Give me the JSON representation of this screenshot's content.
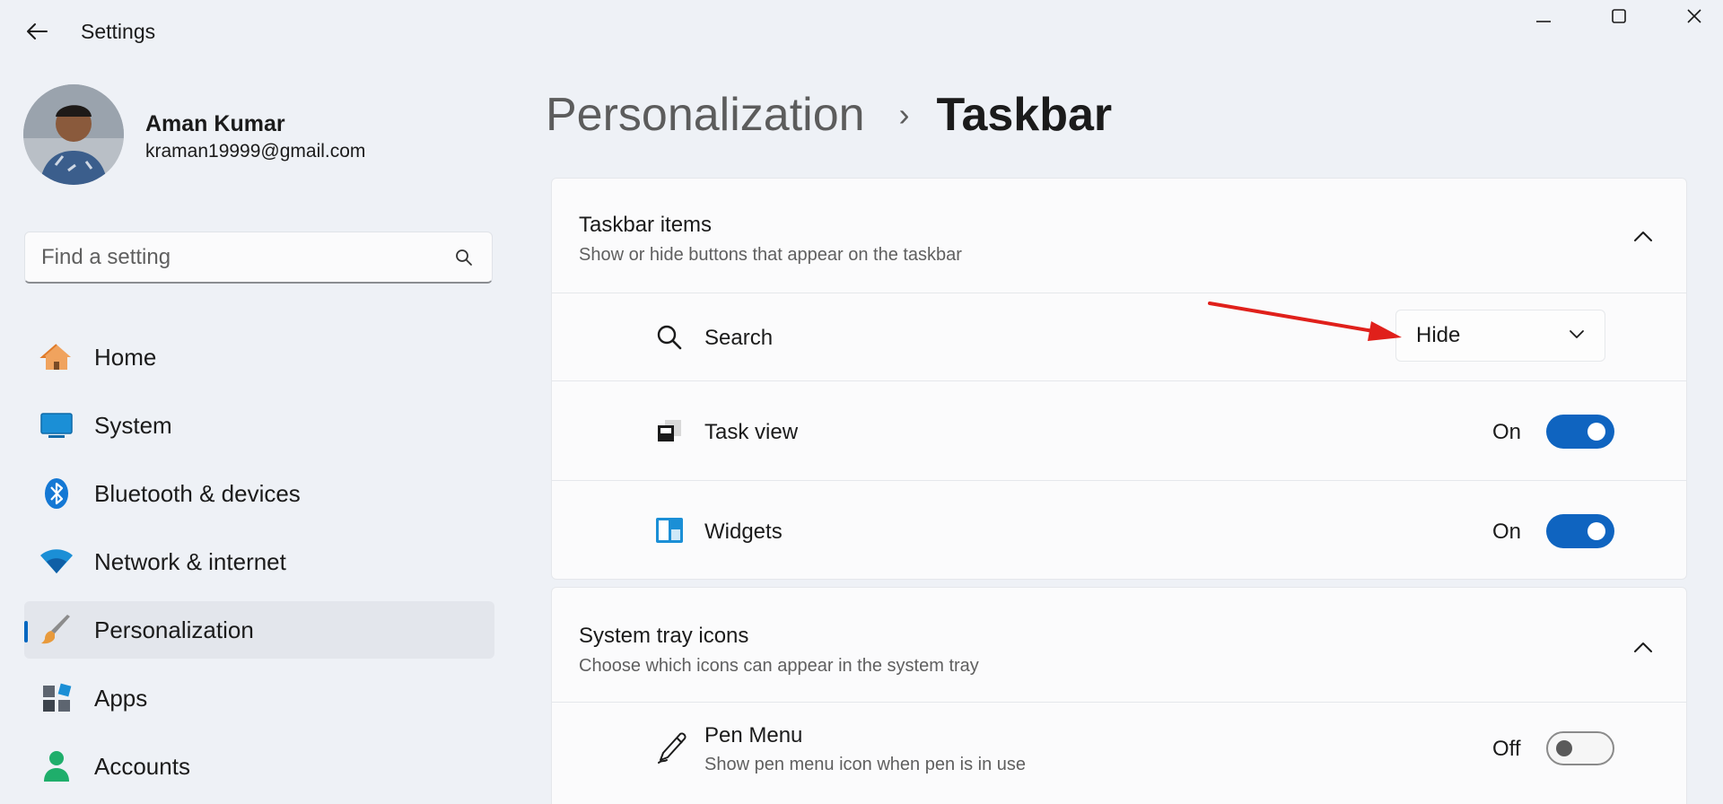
{
  "window": {
    "title": "Settings"
  },
  "user": {
    "name": "Aman Kumar",
    "email": "kraman19999@gmail.com"
  },
  "search": {
    "placeholder": "Find a setting"
  },
  "nav": {
    "items": [
      {
        "label": "Home",
        "icon": "home-icon"
      },
      {
        "label": "System",
        "icon": "display-icon"
      },
      {
        "label": "Bluetooth & devices",
        "icon": "bluetooth-icon"
      },
      {
        "label": "Network & internet",
        "icon": "wifi-icon"
      },
      {
        "label": "Personalization",
        "icon": "brush-icon",
        "active": true
      },
      {
        "label": "Apps",
        "icon": "apps-icon"
      },
      {
        "label": "Accounts",
        "icon": "person-icon"
      }
    ]
  },
  "breadcrumb": {
    "parent": "Personalization",
    "separator": "›",
    "current": "Taskbar"
  },
  "sections": [
    {
      "title": "Taskbar items",
      "subtitle": "Show or hide buttons that appear on the taskbar",
      "rows": [
        {
          "label": "Search",
          "control": "dropdown",
          "value": "Hide",
          "icon": "search-icon"
        },
        {
          "label": "Task view",
          "control": "toggle",
          "state": "On",
          "icon": "task-view-icon"
        },
        {
          "label": "Widgets",
          "control": "toggle",
          "state": "On",
          "icon": "widgets-icon"
        }
      ]
    },
    {
      "title": "System tray icons",
      "subtitle": "Choose which icons can appear in the system tray",
      "rows": [
        {
          "label": "Pen Menu",
          "sublabel": "Show pen menu icon when pen is in use",
          "control": "toggle",
          "state": "Off",
          "icon": "pen-icon"
        }
      ]
    }
  ],
  "colors": {
    "accent": "#0f64c0",
    "annotation_arrow": "#e0201b"
  }
}
